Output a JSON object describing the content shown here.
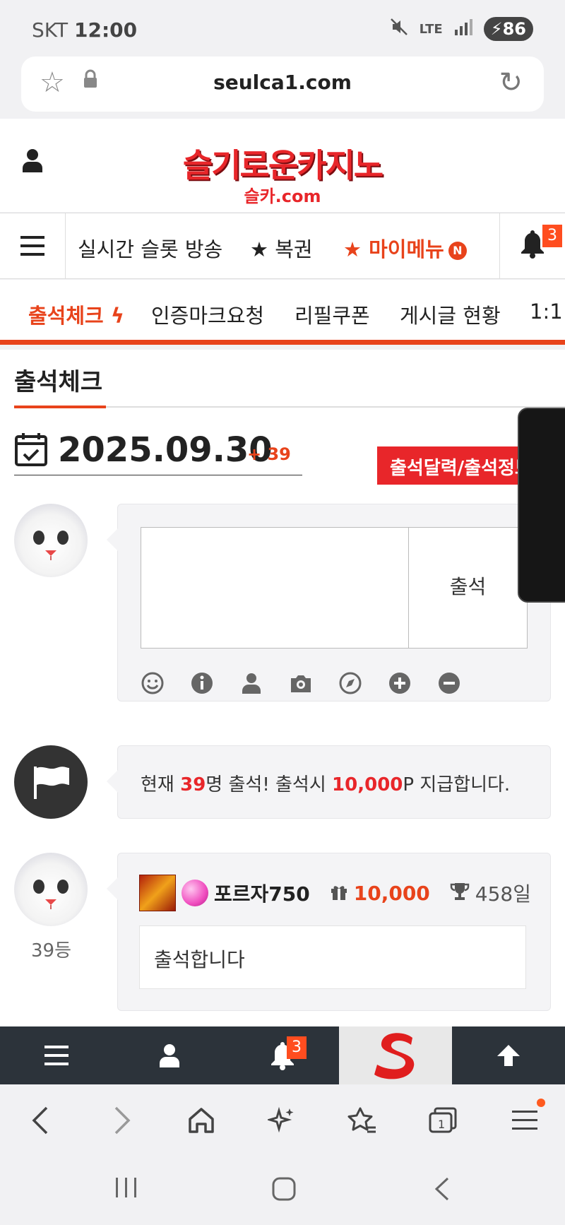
{
  "status_bar": {
    "carrier": "SKT",
    "time": "12:00",
    "network": "LTE",
    "battery": "86"
  },
  "url_bar": {
    "url": "seulca1.com"
  },
  "header": {
    "logo_line1": "슬기로운카지노",
    "logo_line2": "슬카.com"
  },
  "nav": {
    "items": [
      "실시간 슬롯 방송",
      "★ 복권",
      "★ 마이메뉴"
    ],
    "mymenu_badge": "N",
    "bell_count": "3"
  },
  "subtabs": [
    "출석체크",
    "인증마크요청",
    "리필쿠폰",
    "게시글 현황",
    "1:1"
  ],
  "page": {
    "title": "출석체크",
    "date": "2025.09.30",
    "date_plus": "+ 39",
    "calendar_button": "출석달력/출석정보",
    "attend_button": "출석",
    "notice_prefix": "현재 ",
    "notice_count": "39",
    "notice_mid": "명 출석! 출석시 ",
    "notice_points": "10,000",
    "notice_suffix": "P 지급합니다."
  },
  "entry": {
    "rank": "39등",
    "username": "포르자750",
    "points": "10,000",
    "days": "458일",
    "comment": "출석합니다"
  },
  "bottom_bar": {
    "bell_count": "3"
  },
  "colors": {
    "accent": "#e8431b",
    "brand_red": "#e8262a",
    "dark_bar": "#2c333a"
  }
}
